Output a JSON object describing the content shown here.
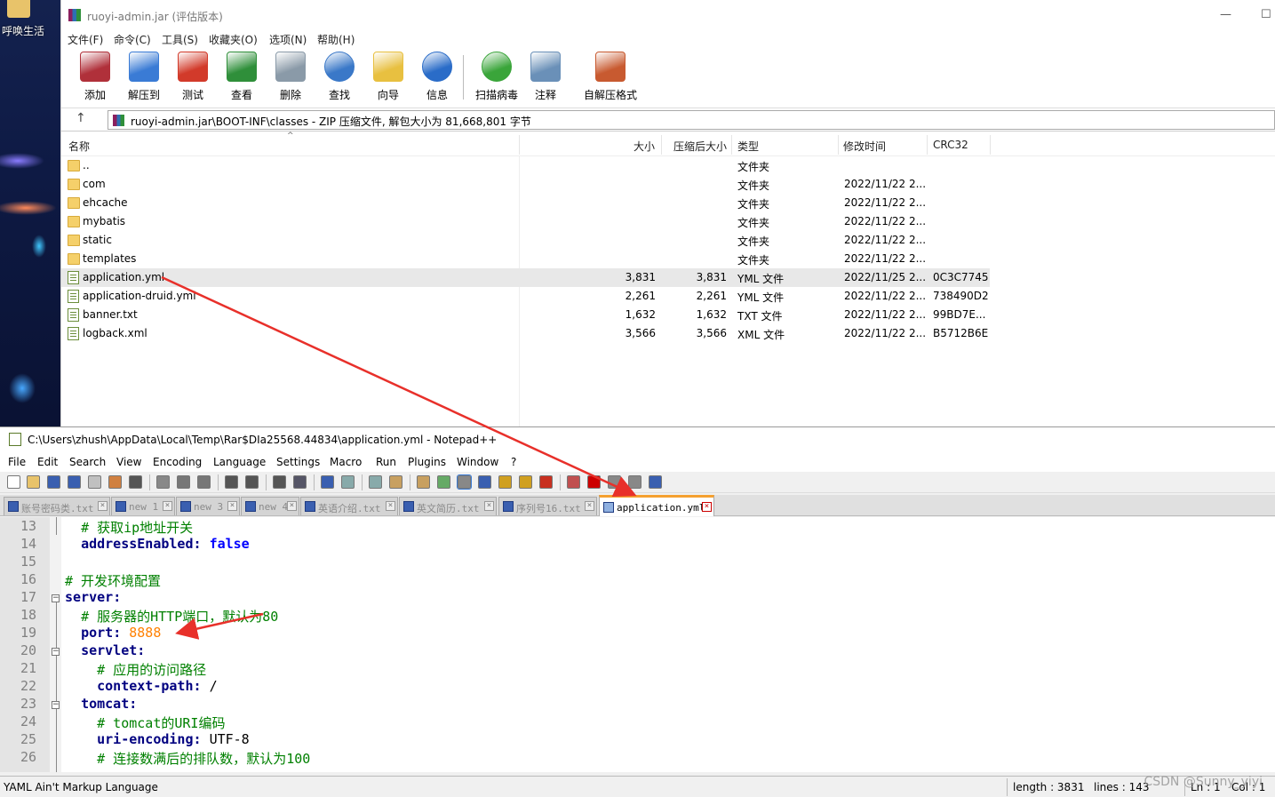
{
  "desktop": {
    "icon_label": "呼唤生活"
  },
  "rar": {
    "title": "ruoyi-admin.jar (评估版本)",
    "window_controls": {
      "minimize": "—",
      "maximize": "☐"
    },
    "menu": [
      "文件(F)",
      "命令(C)",
      "工具(S)",
      "收藏夹(O)",
      "选项(N)",
      "帮助(H)"
    ],
    "toolbar": [
      {
        "label": "添加",
        "icon": "add-archive-icon",
        "color": "#b0303a"
      },
      {
        "label": "解压到",
        "icon": "extract-icon",
        "color": "#3a7bd5"
      },
      {
        "label": "测试",
        "icon": "test-icon",
        "color": "#d23a2a"
      },
      {
        "label": "查看",
        "icon": "view-book-icon",
        "color": "#2f8f3a"
      },
      {
        "label": "删除",
        "icon": "trash-icon",
        "color": "#8a9aa8"
      },
      {
        "label": "查找",
        "icon": "magnifier-icon",
        "color": "#3a78c8"
      },
      {
        "label": "向导",
        "icon": "wand-icon",
        "color": "#e8c040"
      },
      {
        "label": "信息",
        "icon": "info-icon",
        "color": "#2a6cc8"
      },
      {
        "label": "扫描病毒",
        "icon": "virus-scan-icon",
        "color": "#3aa53a"
      },
      {
        "label": "注释",
        "icon": "comment-icon",
        "color": "#6a90b8"
      },
      {
        "label": "自解压格式",
        "icon": "sfx-icon",
        "color": "#c85a30"
      }
    ],
    "address": "ruoyi-admin.jar\\BOOT-INF\\classes - ZIP 压缩文件, 解包大小为 81,668,801 字节",
    "columns": {
      "name": "名称",
      "size": "大小",
      "packed": "压缩后大小",
      "type": "类型",
      "modified": "修改时间",
      "crc": "CRC32"
    },
    "rows": [
      {
        "name": "..",
        "size": "",
        "packed": "",
        "type": "文件夹",
        "modified": "",
        "crc": "",
        "kind": "folder"
      },
      {
        "name": "com",
        "size": "",
        "packed": "",
        "type": "文件夹",
        "modified": "2022/11/22 2...",
        "crc": "",
        "kind": "folder"
      },
      {
        "name": "ehcache",
        "size": "",
        "packed": "",
        "type": "文件夹",
        "modified": "2022/11/22 2...",
        "crc": "",
        "kind": "folder"
      },
      {
        "name": "mybatis",
        "size": "",
        "packed": "",
        "type": "文件夹",
        "modified": "2022/11/22 2...",
        "crc": "",
        "kind": "folder"
      },
      {
        "name": "static",
        "size": "",
        "packed": "",
        "type": "文件夹",
        "modified": "2022/11/22 2...",
        "crc": "",
        "kind": "folder"
      },
      {
        "name": "templates",
        "size": "",
        "packed": "",
        "type": "文件夹",
        "modified": "2022/11/22 2...",
        "crc": "",
        "kind": "folder"
      },
      {
        "name": "application.yml",
        "size": "3,831",
        "packed": "3,831",
        "type": "YML 文件",
        "modified": "2022/11/25 2...",
        "crc": "0C3C7745",
        "kind": "file"
      },
      {
        "name": "application-druid.yml",
        "size": "2,261",
        "packed": "2,261",
        "type": "YML 文件",
        "modified": "2022/11/22 2...",
        "crc": "738490D2",
        "kind": "file"
      },
      {
        "name": "banner.txt",
        "size": "1,632",
        "packed": "1,632",
        "type": "TXT 文件",
        "modified": "2022/11/22 2...",
        "crc": "99BD7E...",
        "kind": "file"
      },
      {
        "name": "logback.xml",
        "size": "3,566",
        "packed": "3,566",
        "type": "XML 文件",
        "modified": "2022/11/22 2...",
        "crc": "B5712B6E",
        "kind": "file"
      }
    ],
    "selected_row": "application.yml"
  },
  "npp": {
    "title": "C:\\Users\\zhush\\AppData\\Local\\Temp\\Rar$DIa25568.44834\\application.yml - Notepad++",
    "menu": [
      "File",
      "Edit",
      "Search",
      "View",
      "Encoding",
      "Language",
      "Settings",
      "Macro",
      "Run",
      "Plugins",
      "Window",
      "?"
    ],
    "tabs": [
      "账号密码类.txt",
      "new 1",
      "new 3",
      "new 4",
      "英语介绍.txt",
      "英文简历.txt",
      "序列号16.txt",
      "application.yml"
    ],
    "active_tab": "application.yml",
    "lines": [
      {
        "n": "13",
        "parts": [
          {
            "t": "  ",
            "c": ""
          },
          {
            "t": "# 获取ip地址开关",
            "c": "cm"
          }
        ]
      },
      {
        "n": "14",
        "parts": [
          {
            "t": "  ",
            "c": ""
          },
          {
            "t": "addressEnabled",
            "c": "key"
          },
          {
            "t": ": ",
            "c": "key"
          },
          {
            "t": "false",
            "c": "kw"
          }
        ]
      },
      {
        "n": "15",
        "parts": []
      },
      {
        "n": "16",
        "parts": [
          {
            "t": "# 开发环境配置",
            "c": "cm"
          }
        ]
      },
      {
        "n": "17",
        "parts": [
          {
            "t": "server",
            "c": "key"
          },
          {
            "t": ":",
            "c": "key"
          }
        ]
      },
      {
        "n": "18",
        "parts": [
          {
            "t": "  ",
            "c": ""
          },
          {
            "t": "# 服务器的HTTP端口，默认为80",
            "c": "cm"
          }
        ]
      },
      {
        "n": "19",
        "parts": [
          {
            "t": "  ",
            "c": ""
          },
          {
            "t": "port",
            "c": "key"
          },
          {
            "t": ": ",
            "c": "key"
          },
          {
            "t": "8888",
            "c": "num"
          }
        ]
      },
      {
        "n": "20",
        "parts": [
          {
            "t": "  ",
            "c": ""
          },
          {
            "t": "servlet",
            "c": "key"
          },
          {
            "t": ":",
            "c": "key"
          }
        ]
      },
      {
        "n": "21",
        "parts": [
          {
            "t": "    ",
            "c": ""
          },
          {
            "t": "# 应用的访问路径",
            "c": "cm"
          }
        ]
      },
      {
        "n": "22",
        "parts": [
          {
            "t": "    ",
            "c": ""
          },
          {
            "t": "context-path",
            "c": "key"
          },
          {
            "t": ": ",
            "c": "key"
          },
          {
            "t": "/",
            "c": ""
          }
        ]
      },
      {
        "n": "23",
        "parts": [
          {
            "t": "  ",
            "c": ""
          },
          {
            "t": "tomcat",
            "c": "key"
          },
          {
            "t": ":",
            "c": "key"
          }
        ]
      },
      {
        "n": "24",
        "parts": [
          {
            "t": "    ",
            "c": ""
          },
          {
            "t": "# tomcat的URI编码",
            "c": "cm"
          }
        ]
      },
      {
        "n": "25",
        "parts": [
          {
            "t": "    ",
            "c": ""
          },
          {
            "t": "uri-encoding",
            "c": "key"
          },
          {
            "t": ": ",
            "c": "key"
          },
          {
            "t": "UTF-8",
            "c": ""
          }
        ]
      },
      {
        "n": "26",
        "parts": [
          {
            "t": "    ",
            "c": ""
          },
          {
            "t": "# 连接数满后的排队数，默认为100",
            "c": "cm"
          }
        ]
      }
    ],
    "status": {
      "language": "YAML Ain't Markup Language",
      "length": "length : 3831",
      "lines": "lines : 143",
      "ln": "Ln : 1",
      "col": "Col : 1"
    }
  },
  "watermark": "CSDN @Sunny_yiyi",
  "colors": {
    "arrow": "#e8302a",
    "tab_accent": "#f5a030",
    "selection": "#e8e8e8"
  }
}
